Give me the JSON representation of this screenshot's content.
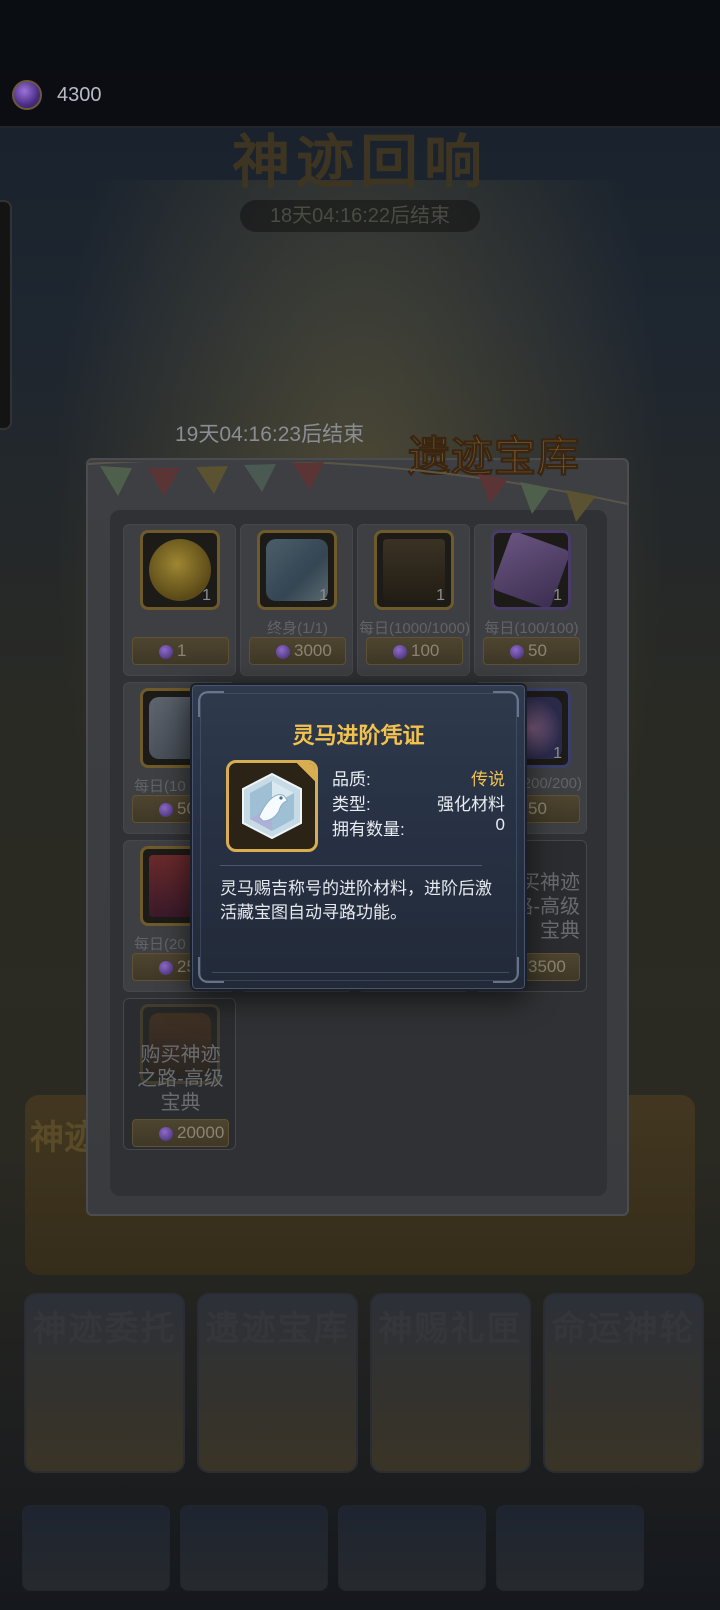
{
  "background": {
    "event_title": "神迹回响",
    "event_timer": "18天04:16:22后结束",
    "banner_label": "神迹",
    "cards": [
      "神迹委托",
      "遗迹宝库",
      "神赐礼匣",
      "命运神轮"
    ],
    "bottom_tabs": [
      "",
      "",
      "",
      ""
    ]
  },
  "topbar": {
    "gem_count": "4300"
  },
  "treasury": {
    "timer": "19天04:16:23后结束",
    "title": "遗迹宝库",
    "items": [
      {
        "qty": "1",
        "limit": "",
        "price": "1",
        "icon": "golden-apple-icon"
      },
      {
        "qty": "1",
        "limit": "终身(1/1)",
        "price": "3000",
        "icon": "spirit-horse-voucher-icon"
      },
      {
        "qty": "1",
        "limit": "每日(1000/1000)",
        "price": "100",
        "icon": "locked-chest-icon"
      },
      {
        "qty": "1",
        "limit": "每日(100/100)",
        "price": "50",
        "icon": "purple-crystal-icon"
      },
      {
        "qty": "",
        "limit": "每日(10",
        "price": "50",
        "icon": "white-crystal-icon"
      },
      {
        "qty": "1",
        "limit": "200/200)",
        "price": "50",
        "icon": "flower-icon"
      },
      {
        "qty": "",
        "limit": "每日(20",
        "price": "250",
        "icon": "gift-box-icon"
      },
      {
        "buy_text": "买神迹\n路-高级\n宝典",
        "price": "3500",
        "icon": "scroll-icon"
      },
      {
        "buy_text": "购买神迹\n之路-高级\n宝典",
        "price": "20000",
        "icon": "fire-chest-icon"
      }
    ]
  },
  "modal": {
    "title": "灵马进阶凭证",
    "quality_label": "品质:",
    "quality_value": "传说",
    "type_label": "类型:",
    "type_value": "强化材料",
    "owned_label": "拥有数量:",
    "owned_value": "0",
    "description": "灵马赐吉称号的进阶材料，进阶后激活藏宝图自动寻路功能。",
    "accent_color": "#f2c24f"
  }
}
